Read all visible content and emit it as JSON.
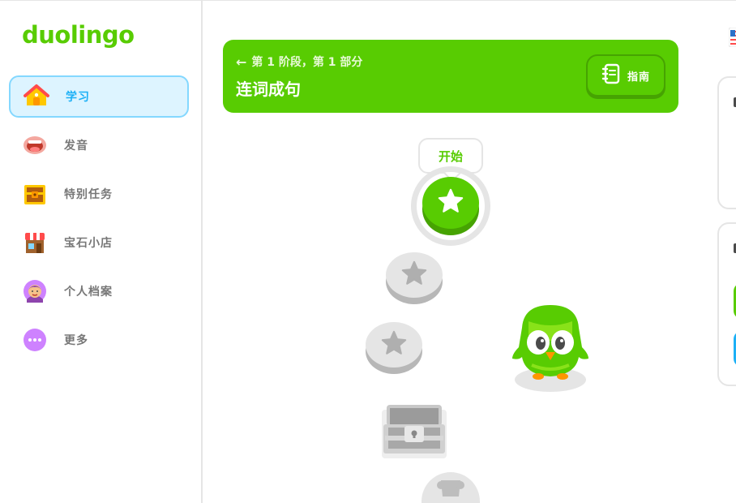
{
  "app": {
    "logo": "duolingo",
    "brand_color": "#58cc02"
  },
  "sidebar": {
    "items": [
      {
        "label": "学习",
        "icon": "home-icon",
        "active": true
      },
      {
        "label": "发音",
        "icon": "mouth-icon",
        "active": false
      },
      {
        "label": "特别任务",
        "icon": "treasure-chest-icon",
        "active": false
      },
      {
        "label": "宝石小店",
        "icon": "shop-icon",
        "active": false
      },
      {
        "label": "个人档案",
        "icon": "avatar-icon",
        "active": false
      },
      {
        "label": "更多",
        "icon": "more-icon",
        "active": false
      }
    ]
  },
  "unit": {
    "section_label": "第 1 阶段，第 1 部分",
    "title": "连词成句",
    "guide_label": "指南",
    "back_icon": "arrow-left-icon",
    "guide_icon": "notebook-icon"
  },
  "path": {
    "start_label": "开始",
    "nodes": [
      {
        "type": "star",
        "state": "active"
      },
      {
        "type": "star",
        "state": "locked"
      },
      {
        "type": "star",
        "state": "locked"
      },
      {
        "type": "chest",
        "state": "locked"
      },
      {
        "type": "trophy",
        "state": "locked"
      }
    ],
    "mascot": "duo-owl-icon"
  },
  "colors": {
    "green": "#58cc02",
    "green_dark": "#46a302",
    "blue": "#1cb0f6",
    "active_bg": "#ddf4ff",
    "active_border": "#84d8ff",
    "locked": "#e5e5e5"
  }
}
